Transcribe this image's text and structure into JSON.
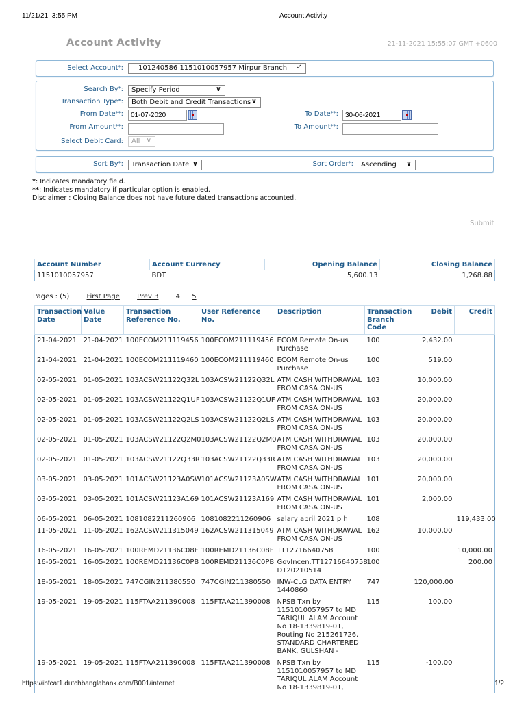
{
  "print_header": {
    "datetime": "11/21/21, 3:55 PM",
    "title": "Account Activity",
    "url": "https://ibfcat1.dutchbanglabank.com/B001/internet",
    "page": "1/2"
  },
  "page": {
    "title": "Account Activity",
    "timestamp": "21-11-2021 15:55:07 GMT +0600"
  },
  "account": {
    "label": "Select Account",
    "value": "101240586 1151010057957 Mirpur Branch"
  },
  "search": {
    "search_by_label": "Search By",
    "search_by": "Specify Period",
    "txn_type_label": "Transaction Type",
    "txn_type": "Both Debit and Credit Transactions",
    "from_date_label": "From Date",
    "from_date": "01-07-2020",
    "to_date_label": "To Date",
    "to_date": "30-06-2021",
    "from_amount_label": "From Amount",
    "from_amount": "",
    "to_amount_label": "To Amount",
    "to_amount": "",
    "debit_card_label": "Select Debit Card",
    "debit_card": "All"
  },
  "sort": {
    "sort_by_label": "Sort By",
    "sort_by": "Transaction Date",
    "sort_order_label": "Sort Order",
    "sort_order": "Ascending"
  },
  "notes": {
    "star": "*",
    "n1": ": Indicates mandatory field.",
    "dstar": "**",
    "n2": ": Indicates mandatory if particular option is enabled.",
    "disclaimer": "Disclaimer :  Closing Balance does not have future dated transactions accounted."
  },
  "submit_label": "Submit",
  "summary": {
    "headers": [
      "Account Number",
      "Account Currency",
      "Opening Balance",
      "Closing Balance"
    ],
    "values": [
      "1151010057957",
      "BDT",
      "5,600.13",
      "1,268.88"
    ]
  },
  "pager": {
    "pages": "Pages : (5)",
    "first": "First Page",
    "prev": "Prev 3",
    "current": "4",
    "next": "5"
  },
  "transactions": {
    "headers": [
      "Transaction Date",
      "Value Date",
      "Transaction Reference No.",
      "User Reference No.",
      "Description",
      "Transaction Branch Code",
      "Debit",
      "Credit"
    ],
    "rows": [
      [
        "21-04-2021",
        "21-04-2021",
        "100ECOM211119456",
        "100ECOM211119456",
        "ECOM Remote On-us Purchase",
        "100",
        "2,432.00",
        ""
      ],
      [
        "21-04-2021",
        "21-04-2021",
        "100ECOM211119460",
        "100ECOM211119460",
        "ECOM Remote On-us Purchase",
        "100",
        "519.00",
        ""
      ],
      [
        "02-05-2021",
        "01-05-2021",
        "103ACSW21122Q32L",
        "103ACSW21122Q32L",
        "ATM CASH WITHDRAWAL FROM CASA ON-US",
        "103",
        "10,000.00",
        ""
      ],
      [
        "02-05-2021",
        "01-05-2021",
        "103ACSW21122Q1UF",
        "103ACSW21122Q1UF",
        "ATM CASH WITHDRAWAL FROM CASA ON-US",
        "103",
        "20,000.00",
        ""
      ],
      [
        "02-05-2021",
        "01-05-2021",
        "103ACSW21122Q2LS",
        "103ACSW21122Q2LS",
        "ATM CASH WITHDRAWAL FROM CASA ON-US",
        "103",
        "20,000.00",
        ""
      ],
      [
        "02-05-2021",
        "01-05-2021",
        "103ACSW21122Q2M0",
        "103ACSW21122Q2M0",
        "ATM CASH WITHDRAWAL FROM CASA ON-US",
        "103",
        "20,000.00",
        ""
      ],
      [
        "02-05-2021",
        "01-05-2021",
        "103ACSW21122Q33R",
        "103ACSW21122Q33R",
        "ATM CASH WITHDRAWAL FROM CASA ON-US",
        "103",
        "20,000.00",
        ""
      ],
      [
        "03-05-2021",
        "03-05-2021",
        "101ACSW21123A0SW",
        "101ACSW21123A0SW",
        "ATM CASH WITHDRAWAL FROM CASA ON-US",
        "101",
        "20,000.00",
        ""
      ],
      [
        "03-05-2021",
        "03-05-2021",
        "101ACSW21123A169",
        "101ACSW21123A169",
        "ATM CASH WITHDRAWAL FROM CASA ON-US",
        "101",
        "2,000.00",
        ""
      ],
      [
        "06-05-2021",
        "06-05-2021",
        "1081082211260906",
        "1081082211260906",
        "salary april 2021 p h",
        "108",
        "",
        "119,433.00"
      ],
      [
        "11-05-2021",
        "11-05-2021",
        "162ACSW211315049",
        "162ACSW211315049",
        "ATM CASH WITHDRAWAL FROM CASA ON-US",
        "162",
        "10,000.00",
        ""
      ],
      [
        "16-05-2021",
        "16-05-2021",
        "100REMD21136C08F",
        "100REMD21136C08F",
        "TT12716640758",
        "100",
        "",
        "10,000.00"
      ],
      [
        "16-05-2021",
        "16-05-2021",
        "100REMD21136C0PB",
        "100REMD21136C0PB",
        "GovIncen.TT12716640758 DT20210514",
        "100",
        "",
        "200.00"
      ],
      [
        "18-05-2021",
        "18-05-2021",
        "747CGIN211380550",
        "747CGIN211380550",
        "INW-CLG DATA ENTRY 1440860",
        "747",
        "120,000.00",
        ""
      ],
      [
        "19-05-2021",
        "19-05-2021",
        "115FTAA211390008",
        "115FTAA211390008",
        "NPSB Txn by 1151010057957 to MD TARIQUL ALAM Account No 18-1339819-01, Routing No 215261726, STANDARD CHARTERED BANK, GULSHAN -",
        "115",
        "100.00",
        ""
      ],
      [
        "19-05-2021",
        "19-05-2021",
        "115FTAA211390008",
        "115FTAA211390008",
        "NPSB Txn by 1151010057957 to MD TARIQUL ALAM Account No 18-1339819-01,",
        "115",
        "-100.00",
        ""
      ]
    ]
  }
}
